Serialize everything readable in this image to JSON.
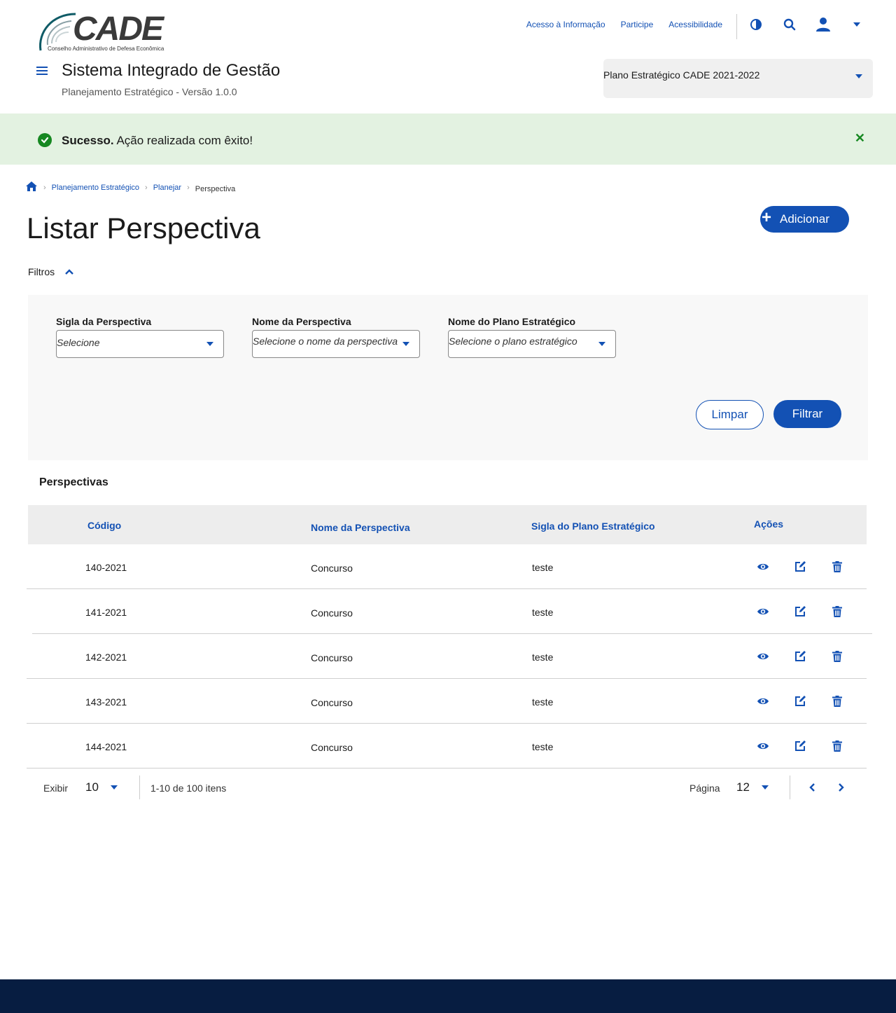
{
  "brand": {
    "logo_text": "CADE",
    "logo_subtitle": "Conselho Administrativo de Defesa Econômica"
  },
  "header": {
    "links": [
      "Acesso à Informação",
      "Participe",
      "Acessibilidade"
    ],
    "icons": [
      "contrast-icon",
      "search-icon",
      "user-icon",
      "chevron-down-icon"
    ],
    "system_title": "Sistema Integrado de Gestão",
    "system_subtitle": "Planejamento Estratégico - Versão 1.0.0",
    "plan_selected": "Plano Estratégico CADE 2021-2022"
  },
  "alert": {
    "strong": "Sucesso.",
    "text": " Ação realizada com êxito!",
    "type": "success"
  },
  "breadcrumb": {
    "items": [
      "Planejamento Estratégico",
      "Planejar"
    ],
    "current": "Perspectiva"
  },
  "page": {
    "title": "Listar Perspectiva",
    "add_label": "Adicionar"
  },
  "filters": {
    "toggle_label": "Filtros",
    "fields": [
      {
        "label": "Sigla da Perspectiva",
        "placeholder": "Selecione"
      },
      {
        "label": "Nome da Perspectiva",
        "placeholder": "Selecione o nome da perspectiva"
      },
      {
        "label": "Nome do Plano Estratégico",
        "placeholder": "Selecione o plano estratégico"
      }
    ],
    "clear_label": "Limpar",
    "submit_label": "Filtrar"
  },
  "table": {
    "title": "Perspectivas",
    "columns": [
      "Código",
      "Nome da Perspectiva",
      "Sigla do Plano Estratégico",
      "Ações"
    ],
    "rows": [
      {
        "codigo": "140-2021",
        "nome": "Concurso",
        "sigla": "teste"
      },
      {
        "codigo": "141-2021",
        "nome": "Concurso",
        "sigla": "teste"
      },
      {
        "codigo": "142-2021",
        "nome": "Concurso",
        "sigla": "teste"
      },
      {
        "codigo": "143-2021",
        "nome": "Concurso",
        "sigla": "teste"
      },
      {
        "codigo": "144-2021",
        "nome": "Concurso",
        "sigla": "teste"
      }
    ]
  },
  "pagination": {
    "show_label": "Exibir",
    "per_page": "10",
    "range_text": "1-10 de 100 itens",
    "page_label": "Página",
    "page": "12"
  },
  "colors": {
    "primary": "#1351b4",
    "success": "#168821",
    "success_bg": "#e3f2e1",
    "footer": "#071d41"
  }
}
